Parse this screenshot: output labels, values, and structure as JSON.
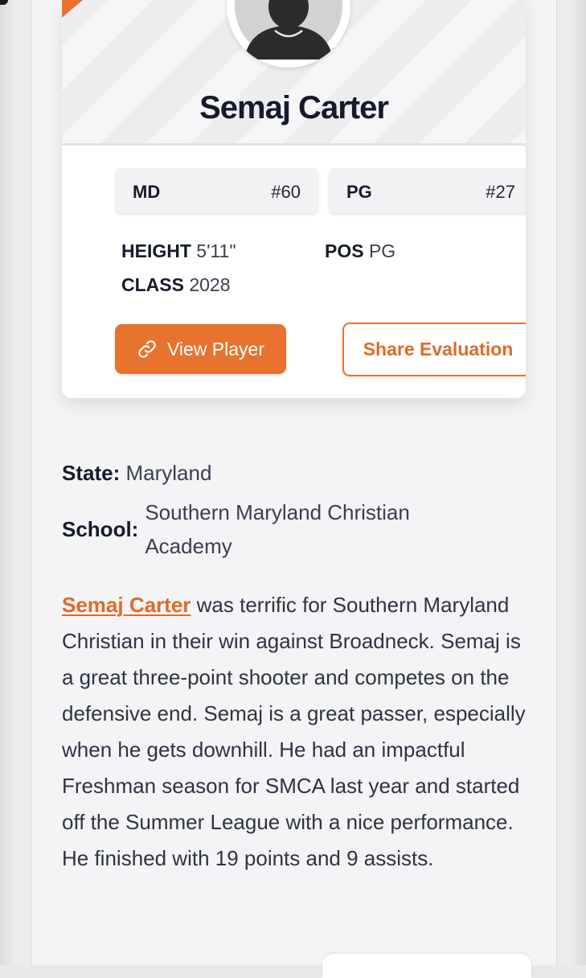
{
  "player": {
    "name": "Semaj Carter",
    "state_code": "MD",
    "state_rank": "#60",
    "position_code": "PG",
    "position_rank": "#27"
  },
  "attributes": {
    "height_label": "HEIGHT",
    "height_value": "5'11\"",
    "class_label": "CLASS",
    "class_value": "2028",
    "pos_label": "POS",
    "pos_value": "PG"
  },
  "buttons": {
    "view_player": "View Player",
    "share_evaluation": "Share Evaluation"
  },
  "info": {
    "state_label": "State:",
    "state_value": "Maryland",
    "school_label": "School:",
    "school_value": "Southern Maryland Christian Academy"
  },
  "bio": {
    "player_link": "Semaj Carter",
    "text": " was terrific for Southern Maryland Christian in their win against Broadneck. Semaj is a great three-point shooter and competes on the defensive end. Semaj is a great passer, especially when he gets downhill. He had an impactful Freshman season for SMCA last year and started off the Summer League with a nice performance. He finished with 19 points and 9 assists."
  },
  "colors": {
    "accent": "#e8732e",
    "text_dark": "#151b2b"
  },
  "icons": {
    "avatar": "person-silhouette-icon",
    "view_player": "link-icon"
  }
}
